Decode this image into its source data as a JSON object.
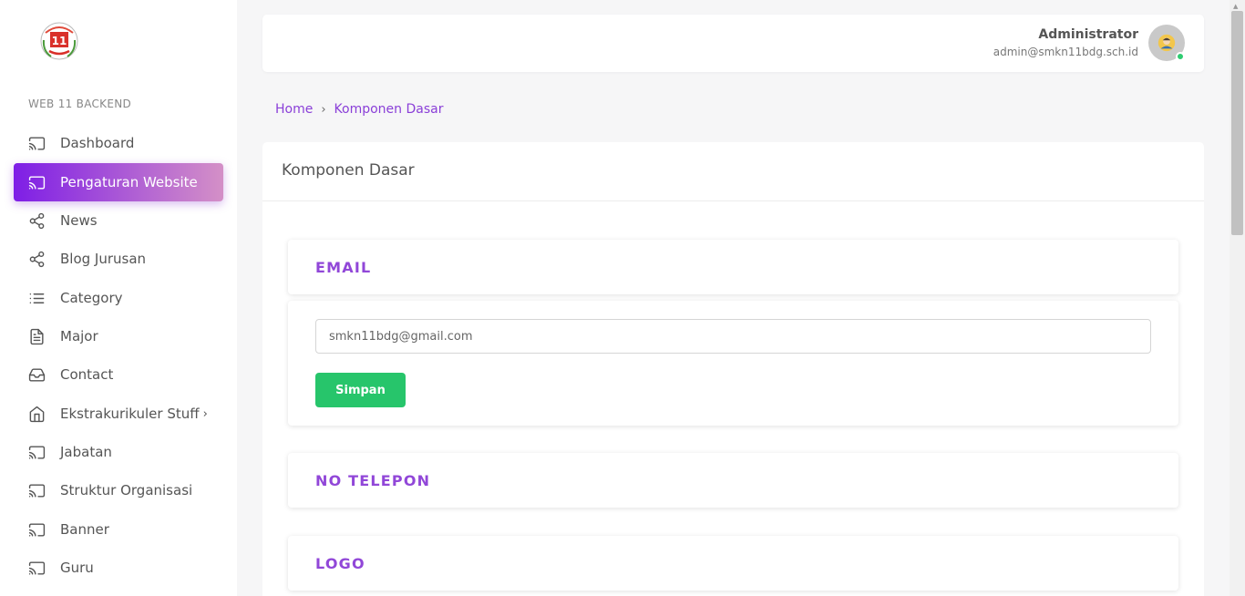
{
  "sidebar": {
    "section_label": "WEB 11 BACKEND",
    "logo_text": "11",
    "items": [
      {
        "label": "Dashboard",
        "icon": "cast-icon",
        "active": false
      },
      {
        "label": "Pengaturan Website",
        "icon": "cast-icon",
        "active": true
      },
      {
        "label": "News",
        "icon": "share-icon",
        "active": false
      },
      {
        "label": "Blog Jurusan",
        "icon": "share-icon",
        "active": false
      },
      {
        "label": "Category",
        "icon": "list-icon",
        "active": false
      },
      {
        "label": "Major",
        "icon": "file-icon",
        "active": false
      },
      {
        "label": "Contact",
        "icon": "inbox-icon",
        "active": false
      },
      {
        "label": "Ekstrakurikuler Stuff",
        "icon": "home-icon",
        "active": false
      },
      {
        "label": "Jabatan",
        "icon": "cast-icon",
        "active": false
      },
      {
        "label": "Struktur Organisasi",
        "icon": "cast-icon",
        "active": false
      },
      {
        "label": "Banner",
        "icon": "cast-icon",
        "active": false
      },
      {
        "label": "Guru",
        "icon": "cast-icon",
        "active": false
      }
    ]
  },
  "header": {
    "user_name": "Administrator",
    "user_email": "admin@smkn11bdg.sch.id",
    "status_color": "#2ecc71"
  },
  "breadcrumb": {
    "home": "Home",
    "current": "Komponen Dasar"
  },
  "main": {
    "title": "Komponen Dasar",
    "sections": {
      "email": {
        "title": "EMAIL",
        "value": "smkn11bdg@gmail.com",
        "save_label": "Simpan"
      },
      "phone": {
        "title": "NO TELEPON"
      },
      "logo": {
        "title": "LOGO"
      }
    }
  },
  "colors": {
    "accent": "#9147d8",
    "active_gradient_start": "#7e1ee6",
    "active_gradient_end": "#d490c7",
    "save_button": "#27c56b"
  }
}
